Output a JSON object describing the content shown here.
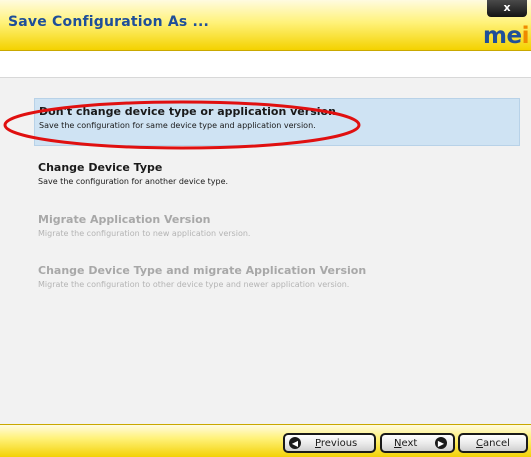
{
  "window": {
    "title": "Save Configuration As ...",
    "close_label": "x",
    "logo_text": "me",
    "logo_accent": "i"
  },
  "options": [
    {
      "title": "Don't change device type or application version",
      "description": "Save the configuration for same device type and application version.",
      "state": "selected"
    },
    {
      "title": "Change Device Type",
      "description": "Save the configuration for another device type.",
      "state": "enabled"
    },
    {
      "title": "Migrate Application Version",
      "description": "Migrate the configuration to new application version.",
      "state": "disabled"
    },
    {
      "title": "Change Device Type and migrate Application Version",
      "description": "Migrate the configuration to other device type and newer application version.",
      "state": "disabled"
    }
  ],
  "footer": {
    "previous_first": "P",
    "previous_rest": "revious",
    "next_first": "N",
    "next_rest": "ext",
    "cancel_first": "C",
    "cancel_rest": "ancel"
  },
  "colors": {
    "title_text": "#1f4f99",
    "bar_yellow": "#f4d200",
    "selected_bg": "#cfe3f3",
    "highlight_ring": "#e01010",
    "logo_accent": "#ee8a00"
  },
  "icons": {
    "previous": "arrow-left-icon",
    "next": "arrow-right-icon",
    "close": "close-icon"
  }
}
